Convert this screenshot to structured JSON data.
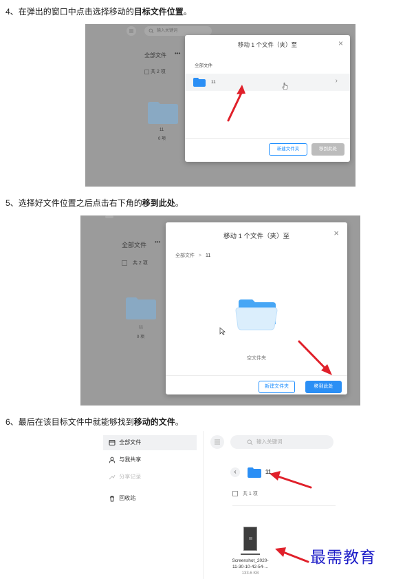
{
  "steps": [
    {
      "number": "4、",
      "text": "在弹出的窗口中点击选择移动的",
      "bold": "目标文件位置",
      "end": "。"
    },
    {
      "number": "5、",
      "text": "选择好文件位置之后点击右下角的",
      "bold": "移到此处",
      "end": "。"
    },
    {
      "number": "6、",
      "text": "最后在该目标文件中就能够找到",
      "bold": "移动的文件",
      "end": "。"
    }
  ],
  "shot1": {
    "search_placeholder": "输入关键词",
    "all_files": "全部文件",
    "more": "•••",
    "count": "共 2 项",
    "folder_name": "11",
    "folder_meta": "0 项",
    "modal": {
      "title": "移动 1 个文件（夹）至",
      "close": "×",
      "section": "全部文件",
      "row_label": "11",
      "row_chevron": "›",
      "new_folder": "新建文件夹",
      "move_here": "移到此处"
    }
  },
  "shot2": {
    "all_files": "全部文件",
    "more": "•••",
    "count": "共 2 项",
    "folder_name": "11",
    "folder_meta": "0 项",
    "modal": {
      "title": "移动 1 个文件（夹）至",
      "close": "×",
      "breadcrumb_root": "全部文件",
      "breadcrumb_sep": ">",
      "breadcrumb_current": "11",
      "empty_text": "空文件夹",
      "new_folder": "新建文件夹",
      "move_here": "移到此处"
    }
  },
  "shot3": {
    "sidebar": [
      "全部文件",
      "与我共享",
      "分享记录",
      "回收站"
    ],
    "search_placeholder": "输入关键词",
    "back": "‹",
    "folder_title": "11",
    "count": "共 1 项",
    "file_name_lines": [
      "Screenshot_2020-",
      "11-30-10-42-54-..."
    ],
    "file_size": "133.6 KB",
    "watermark": "最需教育"
  },
  "colors": {
    "accent": "#1f8fff",
    "move_disabled": "#bcbcbc",
    "move_enabled": "#2b8ff5",
    "arrow": "#e0202a",
    "watermark": "#1d1dc8"
  },
  "icons": [
    "menu-icon",
    "search-icon",
    "folder-icon",
    "close-icon",
    "chevron-right-icon",
    "cursor-icon",
    "file-icon",
    "user-icon",
    "share-icon",
    "trash-icon",
    "arrow-annotation"
  ]
}
